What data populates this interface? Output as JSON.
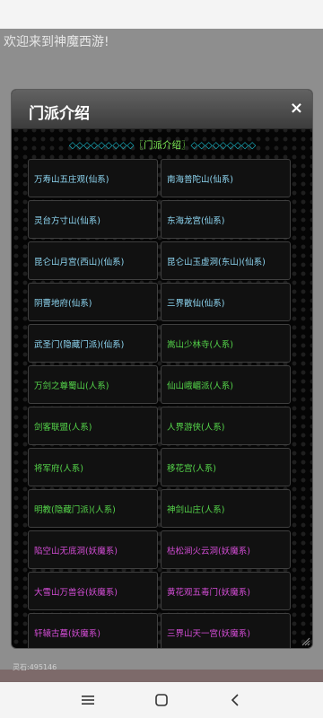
{
  "page": {
    "welcome": "欢迎来到神魔西游!",
    "money": "灵石:495146"
  },
  "modal": {
    "title": "门派介绍",
    "close": "×"
  },
  "section": {
    "left_deco": "◇◇◇◇◇◇◇◇◇",
    "label": "〖门派介绍〗",
    "right_deco": "◇◇◇◇◇◇◇◇◇"
  },
  "sects": [
    {
      "name": "万寿山五庄观(仙系)",
      "group": "xian"
    },
    {
      "name": "南海普陀山(仙系)",
      "group": "xian"
    },
    {
      "name": "灵台方寸山(仙系)",
      "group": "xian"
    },
    {
      "name": "东海龙宫(仙系)",
      "group": "xian"
    },
    {
      "name": "昆仑山月宫(西山)(仙系)",
      "group": "xian"
    },
    {
      "name": "昆仑山玉虚洞(东山)(仙系)",
      "group": "xian"
    },
    {
      "name": "阴曹地府(仙系)",
      "group": "xian"
    },
    {
      "name": "三界散仙(仙系)",
      "group": "xian"
    },
    {
      "name": "武圣门(隐藏门派)(仙系)",
      "group": "xian"
    },
    {
      "name": "嵩山少林寺(人系)",
      "group": "ren"
    },
    {
      "name": "万剑之尊蜀山(人系)",
      "group": "ren"
    },
    {
      "name": "仙山峨嵋派(人系)",
      "group": "ren"
    },
    {
      "name": "剑客联盟(人系)",
      "group": "ren"
    },
    {
      "name": "人界游侠(人系)",
      "group": "ren"
    },
    {
      "name": "将军府(人系)",
      "group": "ren"
    },
    {
      "name": "移花宫(人系)",
      "group": "ren"
    },
    {
      "name": "明教(隐藏门派)(人系)",
      "group": "ren"
    },
    {
      "name": "神剑山庄(人系)",
      "group": "ren"
    },
    {
      "name": "陷空山无底洞(妖魔系)",
      "group": "yao"
    },
    {
      "name": "枯松涧火云洞(妖魔系)",
      "group": "yao"
    },
    {
      "name": "大雪山万兽谷(妖魔系)",
      "group": "yao"
    },
    {
      "name": "黄花观五毒门(妖魔系)",
      "group": "yao"
    },
    {
      "name": "轩辕古墓(妖魔系)",
      "group": "yao"
    },
    {
      "name": "三界山天一宫(妖魔系)",
      "group": "yao"
    }
  ],
  "colors": {
    "xian": "#8ed7f3",
    "ren": "#55d64a",
    "yao": "#d44dd6",
    "section": "#1cc6d8",
    "section_label": "#7fef58"
  },
  "icons": {
    "close": "close-icon",
    "resize": "resize-handle-icon",
    "nav_menu": "menu-icon",
    "nav_home": "home-icon",
    "nav_back": "back-icon"
  }
}
